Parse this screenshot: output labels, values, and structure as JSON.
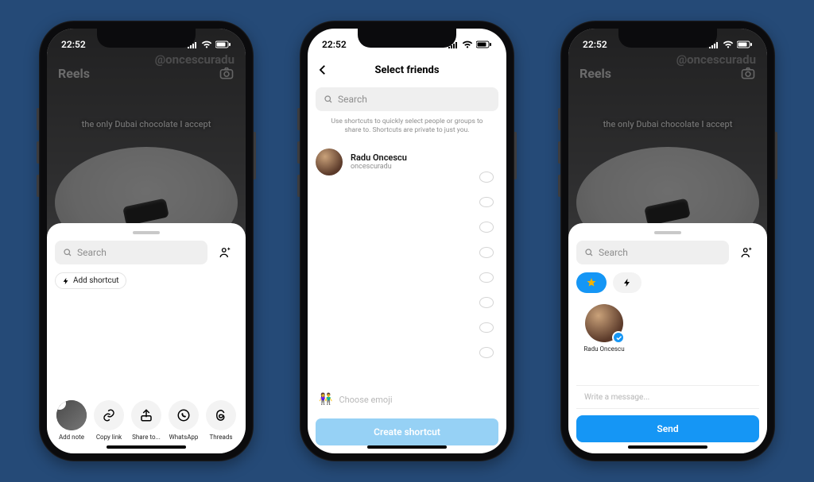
{
  "status": {
    "time": "22:52"
  },
  "watermark": "@oncescuradu",
  "reel": {
    "header": "Reels",
    "caption": "the only Dubai chocolate I accept"
  },
  "share_sheet": {
    "search_placeholder": "Search",
    "add_shortcut": "Add shortcut",
    "actions": {
      "add_note": "Add note",
      "copy_link": "Copy link",
      "share_to": "Share to...",
      "whatsapp": "WhatsApp",
      "threads": "Threads"
    }
  },
  "select_friends": {
    "title": "Select friends",
    "search_placeholder": "Search",
    "help": "Use shortcuts to quickly select people or groups to share to. Shortcuts are private to just you.",
    "contact": {
      "name": "Radu Oncescu",
      "username": "oncescuradu"
    },
    "choose_emoji": "Choose emoji",
    "create": "Create shortcut"
  },
  "send_sheet": {
    "search_placeholder": "Search",
    "contact_name": "Radu Oncescu",
    "message_placeholder": "Write a message...",
    "send": "Send"
  },
  "colors": {
    "background": "#254a77",
    "ig_blue": "#1596f5",
    "ig_blue_light": "#96d1f5"
  }
}
